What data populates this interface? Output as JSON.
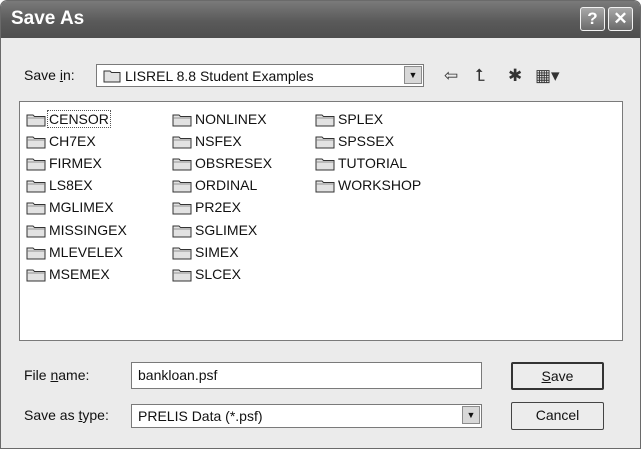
{
  "window": {
    "title": "Save As",
    "help_glyph": "?",
    "close_glyph": "✕"
  },
  "location": {
    "label_pre": "Save ",
    "label_key": "i",
    "label_post": "n:",
    "value": "LISREL 8.8 Student Examples",
    "icon": "folder-icon"
  },
  "toolbar": {
    "icons": [
      "back-arrow-icon",
      "up-one-level-icon",
      "new-folder-icon",
      "view-menu-icon"
    ],
    "back_glyph": "⇦",
    "up_glyph": "⮤",
    "new_glyph": "✱",
    "view_glyph": "▦▾"
  },
  "folders": {
    "col1": [
      "CENSOR",
      "CH7EX",
      "FIRMEX",
      "LS8EX",
      "MGLIMEX",
      "MISSINGEX",
      "MLEVELEX",
      "MSEMEX"
    ],
    "col2": [
      "NONLINEX",
      "NSFEX",
      "OBSRESEX",
      "ORDINAL",
      "PR2EX",
      "SGLIMEX",
      "SIMEX",
      "SLCEX"
    ],
    "col3": [
      "SPLEX",
      "SPSSEX",
      "TUTORIAL",
      "WORKSHOP"
    ]
  },
  "file_name": {
    "label_pre": "File ",
    "label_key": "n",
    "label_post": "ame:",
    "value": "bankloan.psf"
  },
  "file_type": {
    "label_pre": "Save as ",
    "label_key": "t",
    "label_post": "ype:",
    "value": "PRELIS Data (*.psf)"
  },
  "buttons": {
    "save_key": "S",
    "save_rest": "ave",
    "cancel": "Cancel"
  },
  "colors": {
    "titlebar": "#5a5a5a",
    "dialog_bg": "#ebebeb",
    "folder_fill": "#e2e2e2"
  }
}
